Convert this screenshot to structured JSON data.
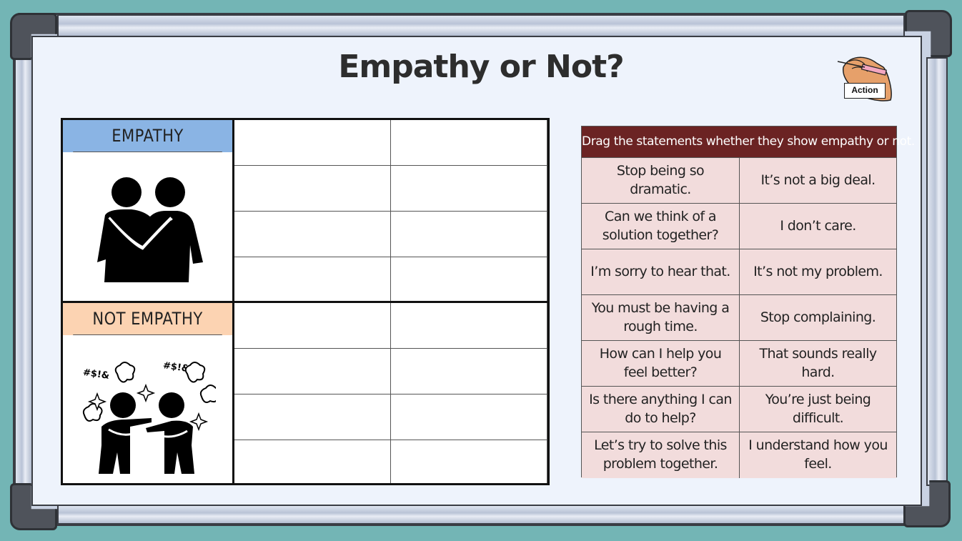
{
  "page": {
    "title": "Empathy or Not?",
    "action_label": "Action"
  },
  "categories": [
    {
      "label": "EMPATHY",
      "color": "#8ab4e4",
      "icon": "hugging-people-icon"
    },
    {
      "label": "NOT EMPATHY",
      "color": "#fcd3b2",
      "icon": "arguing-people-icon",
      "icon_text": "#$!&"
    }
  ],
  "statements": {
    "instruction": "Drag the statements whether they show empathy or not.",
    "header_color": "#6b2323",
    "cell_color": "#f2dcdc",
    "rows": [
      [
        "Stop being so dramatic.",
        "It’s not a big deal."
      ],
      [
        "Can we think of a solution together?",
        "I don’t care."
      ],
      [
        "I’m sorry to hear that.",
        "It’s not my problem."
      ],
      [
        "You must be having a rough time.",
        "Stop complaining."
      ],
      [
        "How can I help you feel better?",
        "That sounds really hard."
      ],
      [
        "Is there anything I can do to help?",
        "You’re just being difficult."
      ],
      [
        "Let’s try to solve this problem together.",
        "I understand how you feel."
      ]
    ]
  }
}
